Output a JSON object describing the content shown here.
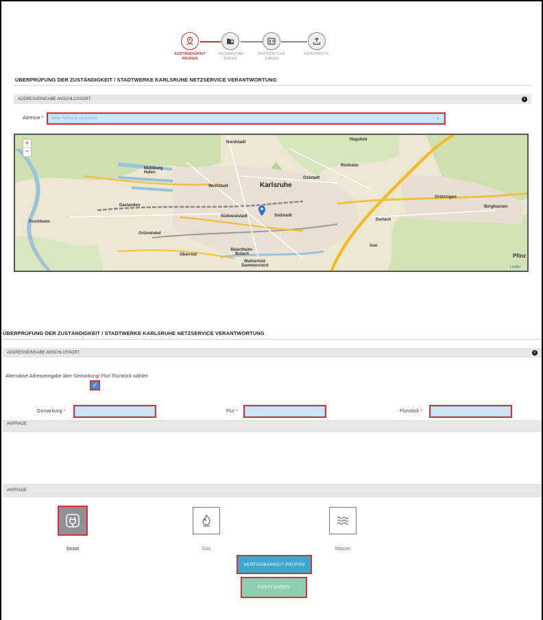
{
  "stepper": {
    "steps": [
      {
        "line1": "ZUSTÄNDIGKEIT",
        "line2": "PRÜFEN",
        "icon": "location-person-icon"
      },
      {
        "line1": "TECHNISCHE",
        "line2": "DATEN",
        "icon": "folder-icon"
      },
      {
        "line1": "PERSÖNLICHE",
        "line2": "DATEN",
        "icon": "id-card-icon"
      },
      {
        "line1": "DOKUMENTE",
        "line2": "",
        "icon": "upload-icon"
      }
    ]
  },
  "section1": {
    "title": "ÜBERPRÜFUNG DER ZUSTÄNDIGKEIT / STADTWERKE KARLSRUHE NETZSERVICE VERANTWORTUNG",
    "bar_label": "ADDRESSEINGABE ANSCHLUSSORT",
    "address_label": "Adresse",
    "required_mark": "*",
    "address_placeholder": "Bitte Adresse eingeben"
  },
  "map": {
    "zoom_in": "+",
    "zoom_out": "−",
    "places": [
      "Nordstadt",
      "Hagsfeld",
      "Mühlburg Hafen",
      "Rintheim",
      "Oststadt",
      "Weststadt",
      "Karlsruhe",
      "Grötzingen",
      "Daxlanden",
      "Südweststadt",
      "Südstadt",
      "Durlach",
      "Berghausen",
      "Forchheim",
      "Grünwinkel",
      "Oberreut",
      "Beiertheim-Bulach",
      "Weiherfeld-Dammerstock",
      "Aue",
      "Pfinz"
    ],
    "attribution": "Leaflet"
  },
  "section2": {
    "title": "ÜBERPRÜFUNG DER ZUSTÄNDIGKEIT / STADTWERKE KARLSRUHE NETZSERVICE VERANTWORTUNG",
    "bar_label": "ADDRESSEINGABE ANSCHLUSSORT",
    "alt_label": "Alternative Adresseingabe über Gemarkung/ Flur/ Flurstück wählen",
    "alt_checked": true,
    "gemarkung_label": "Gemarkung",
    "flur_label": "Flur",
    "flurstueck_label": "Flurstück",
    "required_mark": "*",
    "anfrage_bar": "ANFRAGE"
  },
  "section3": {
    "anfrage_bar": "ANFRAGE",
    "services": [
      {
        "name": "Strom",
        "icon": "plug-icon",
        "selected": true
      },
      {
        "name": "Gas",
        "icon": "flame-icon",
        "selected": false
      },
      {
        "name": "Wasser",
        "icon": "water-waves-icon",
        "selected": false
      }
    ],
    "check_button": "VERFÜGBARKEIT PRÜFEN",
    "continue_button": "FORTFAHREN"
  },
  "colors": {
    "accent_red": "#c0392b",
    "highlight_red": "#d9303a",
    "input_blue": "#c8e6f6",
    "button_blue": "#3ea7cf",
    "button_green": "#8fcfae"
  }
}
